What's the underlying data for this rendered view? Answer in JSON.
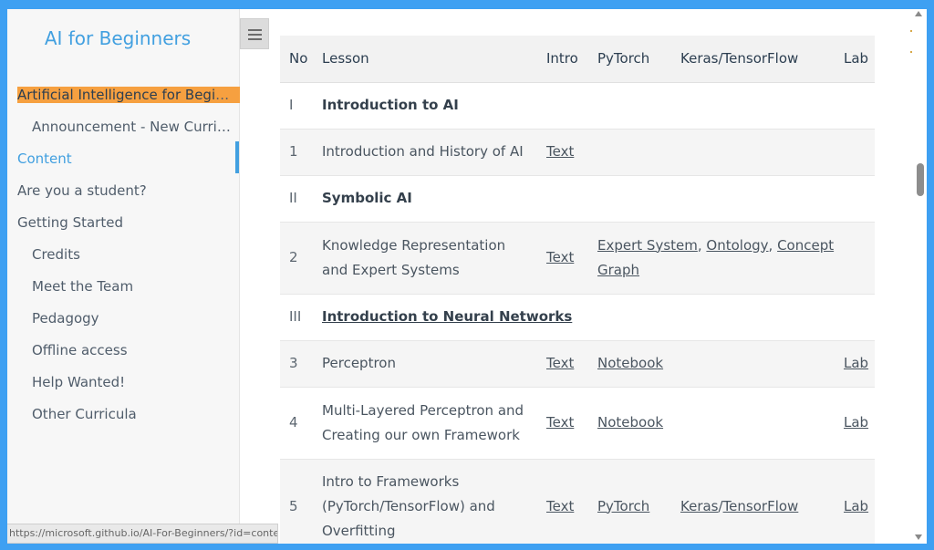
{
  "sidebar": {
    "title": "AI for Beginners",
    "items": [
      {
        "label": "Artificial Intelligence for Beginners - A Curriculum",
        "level": 1,
        "highlighted": true
      },
      {
        "label": "Announcement - New Curriculum on Generative AI",
        "level": 2
      },
      {
        "label": "Content",
        "level": 1,
        "active": true
      },
      {
        "label": "Are you a student?",
        "level": 1
      },
      {
        "label": "Getting Started",
        "level": 1
      },
      {
        "label": "Credits",
        "level": 2
      },
      {
        "label": "Meet the Team",
        "level": 2
      },
      {
        "label": "Pedagogy",
        "level": 2
      },
      {
        "label": "Offline access",
        "level": 2
      },
      {
        "label": "Help Wanted!",
        "level": 2
      },
      {
        "label": "Other Curricula",
        "level": 2
      }
    ],
    "menu_icon": "hamburger-icon",
    "status_url": "https://microsoft.github.io/AI-For-Beginners/?id=content"
  },
  "table": {
    "headers": [
      "No",
      "Lesson",
      "Intro",
      "PyTorch",
      "Keras/TensorFlow",
      "Lab"
    ],
    "rows": {
      "r0": {
        "no": "I",
        "lesson": "Introduction to AI"
      },
      "r1": {
        "no": "1",
        "lesson": "Introduction and History of AI",
        "intro": "Text"
      },
      "r2": {
        "no": "II",
        "lesson": "Symbolic AI"
      },
      "r3": {
        "no": "2",
        "lesson": "Knowledge Representation and Expert Systems",
        "intro": "Text",
        "pytorch": [
          "Expert System",
          "Ontology",
          "Concept Graph"
        ]
      },
      "r4": {
        "no": "III",
        "lesson": "Introduction to Neural Networks"
      },
      "r5": {
        "no": "3",
        "lesson": "Perceptron",
        "intro": "Text",
        "pytorch": "Notebook",
        "lab": "Lab"
      },
      "r6": {
        "no": "4",
        "lesson": "Multi-Layered Perceptron and Creating our own Framework",
        "intro": "Text",
        "pytorch": "Notebook",
        "lab": "Lab"
      },
      "r7": {
        "no": "5",
        "lesson": "Intro to Frameworks (PyTorch/TensorFlow) and Overfitting",
        "intro": "Text",
        "pytorch": "PyTorch",
        "keras": [
          "Keras",
          "TensorFlow"
        ],
        "lab": "Lab"
      }
    }
  },
  "colors": {
    "accent": "#42a0e0",
    "highlight": "#f6a040",
    "frame": "#3ea0f2"
  }
}
